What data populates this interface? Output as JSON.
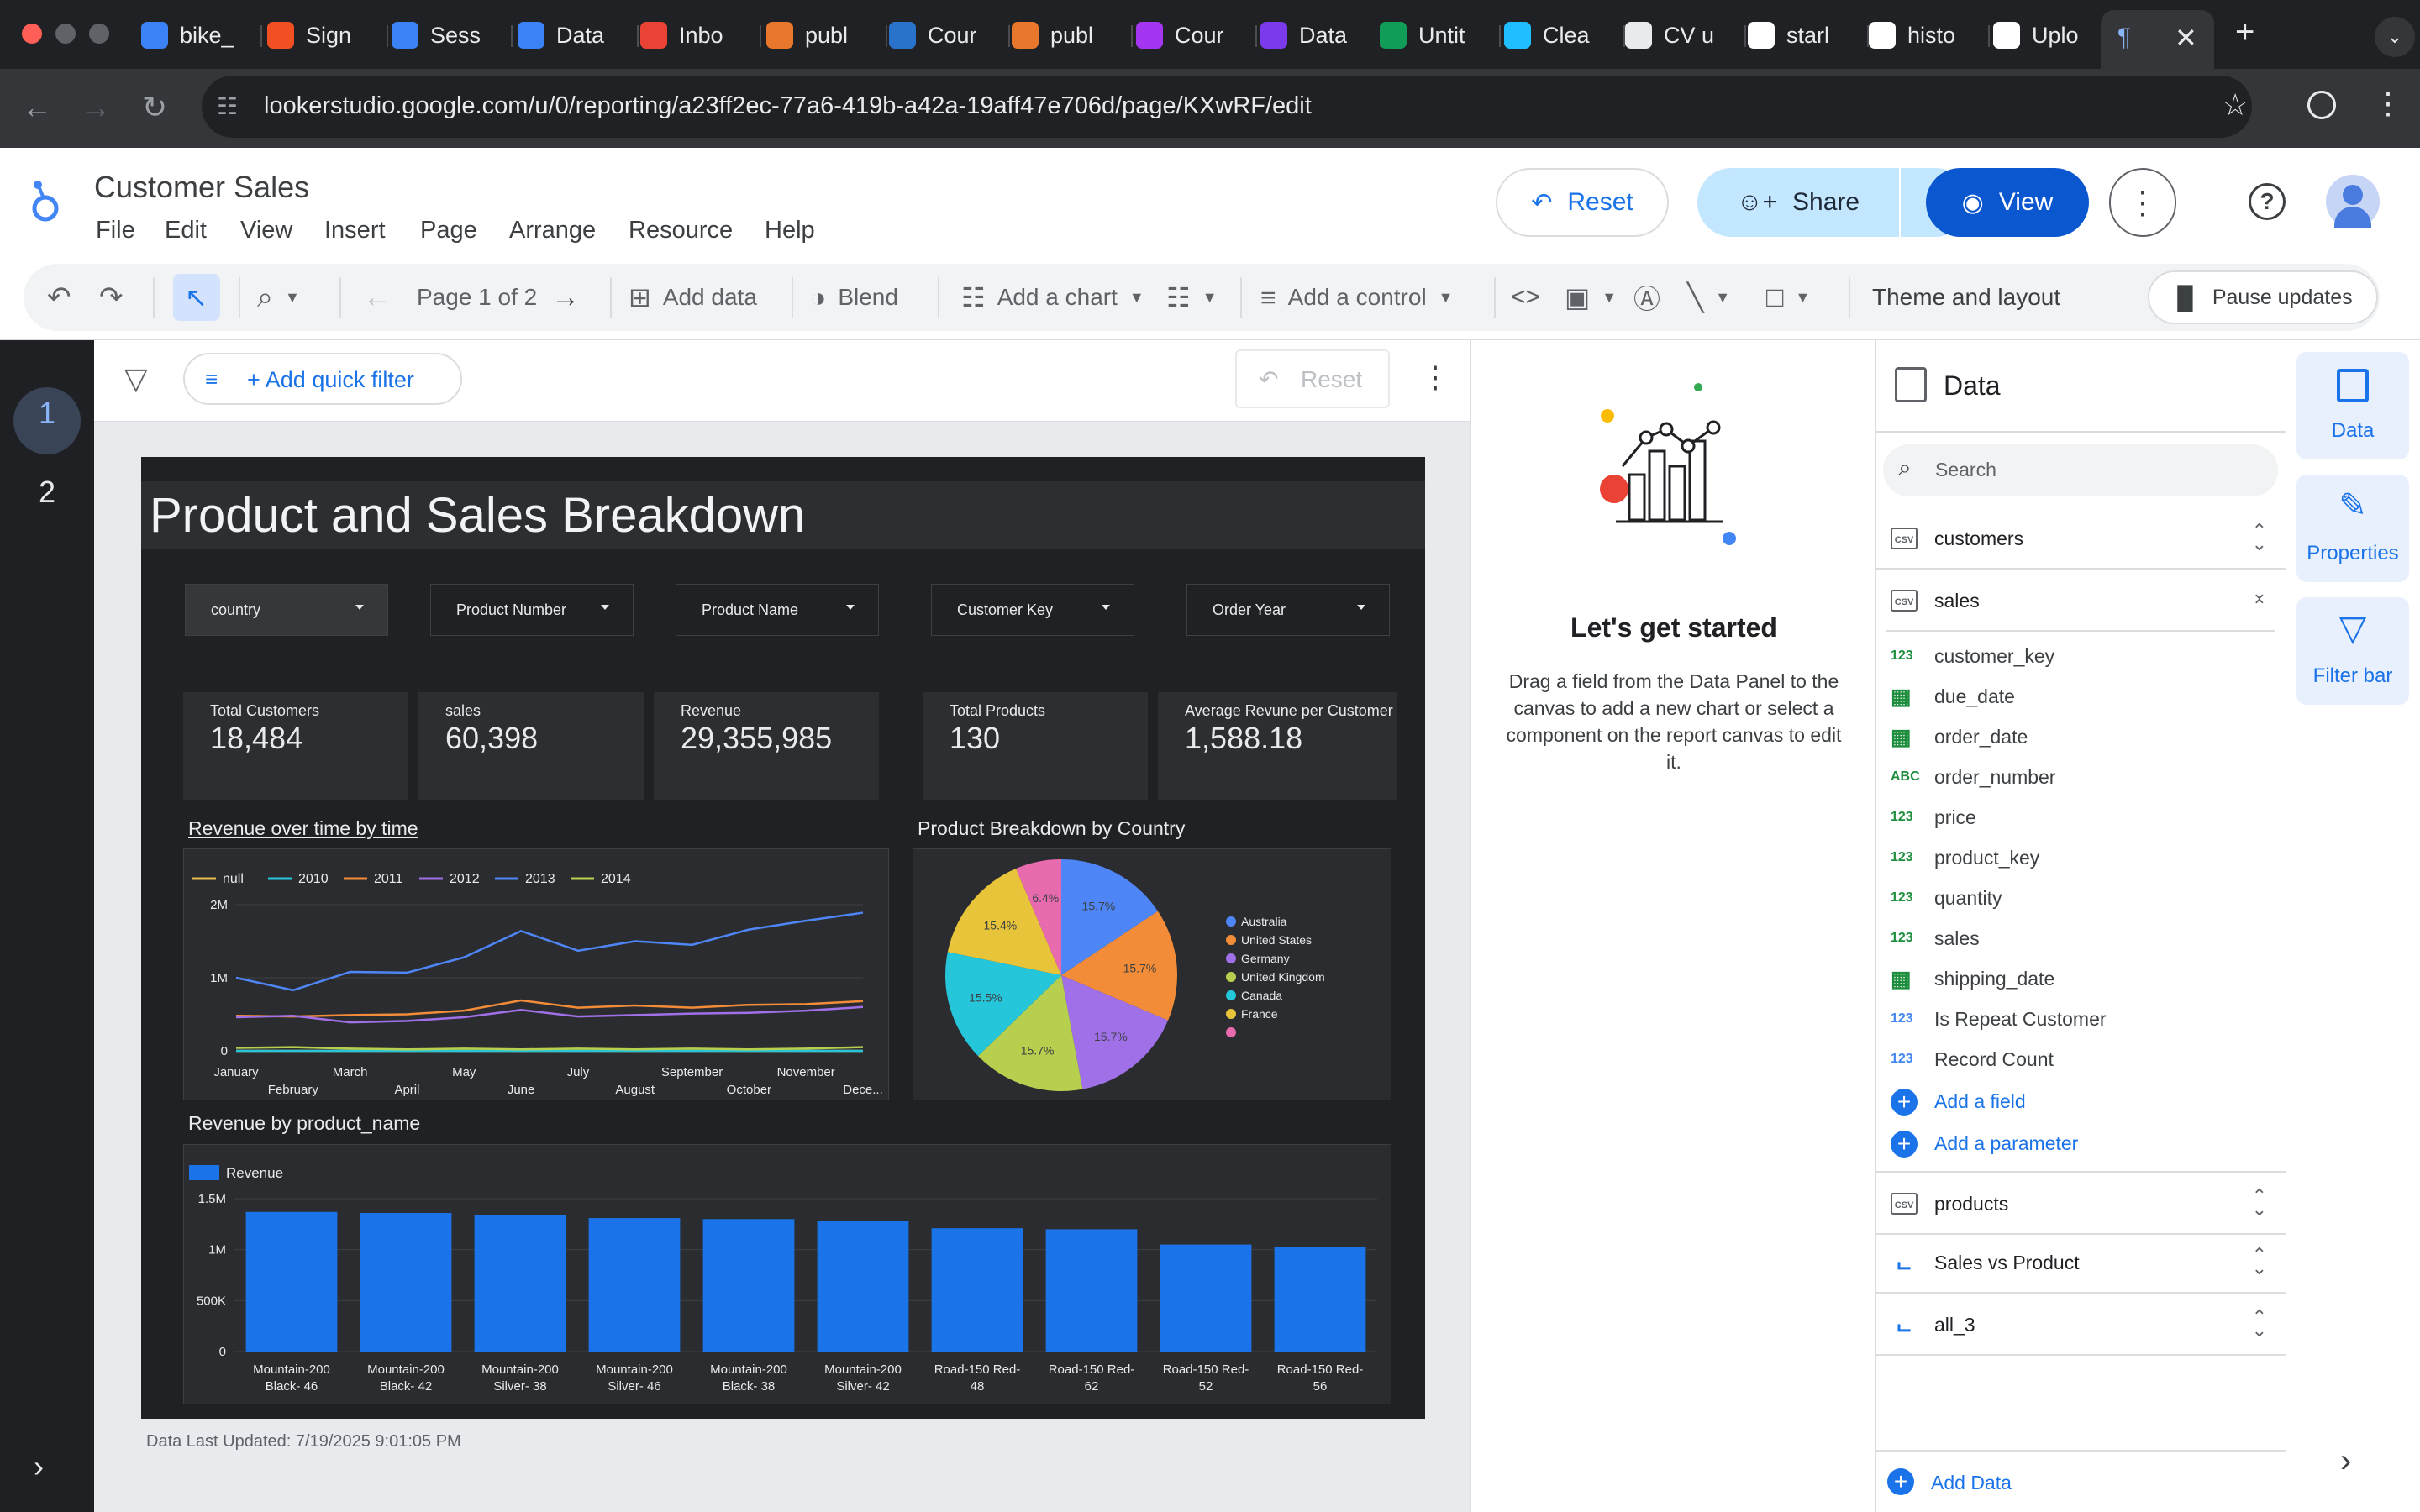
{
  "browser": {
    "tabs": [
      {
        "label": "bike_",
        "icon": "azure-icon",
        "color": "#3b82f6"
      },
      {
        "label": "Sign",
        "icon": "microsoft-icon",
        "color": "#f25022"
      },
      {
        "label": "Sess",
        "icon": "azure-icon",
        "color": "#3b82f6"
      },
      {
        "label": "Data",
        "icon": "azure-icon",
        "color": "#3b82f6"
      },
      {
        "label": "Inbo",
        "icon": "gmail-icon",
        "color": "#ea4335"
      },
      {
        "label": "publ",
        "icon": "tableau-icon",
        "color": "#e8762b"
      },
      {
        "label": "Cour",
        "icon": "coursera-icon",
        "color": "#2a73cc"
      },
      {
        "label": "publ",
        "icon": "tableau-icon",
        "color": "#e8762b"
      },
      {
        "label": "Cour",
        "icon": "udemy-icon",
        "color": "#a435f0"
      },
      {
        "label": "Data",
        "icon": "datacamp-icon",
        "color": "#7c3aed"
      },
      {
        "label": "Untit",
        "icon": "sheets-icon",
        "color": "#0f9d58"
      },
      {
        "label": "Clea",
        "icon": "kaggle-icon",
        "color": "#20beff"
      },
      {
        "label": "CV u",
        "icon": "openai-icon",
        "color": "#e8eaed"
      },
      {
        "label": "starl",
        "icon": "google-icon",
        "color": "#ffffff"
      },
      {
        "label": "histo",
        "icon": "google-icon",
        "color": "#ffffff"
      },
      {
        "label": "Uplo",
        "icon": "github-icon",
        "color": "#ffffff"
      }
    ],
    "active_tab_label": "",
    "url": "lookerstudio.google.com/u/0/reporting/a23ff2ec-77a6-419b-a42a-19aff47e706d/page/KXwRF/edit"
  },
  "header": {
    "title": "Customer Sales",
    "menu": [
      "File",
      "Edit",
      "View",
      "Insert",
      "Page",
      "Arrange",
      "Resource",
      "Help"
    ],
    "reset_label": "Reset",
    "share_label": "Share",
    "view_label": "View"
  },
  "toolbar": {
    "page_label": "Page 1 of 2",
    "add_data": "Add data",
    "blend": "Blend",
    "add_chart": "Add a chart",
    "add_control": "Add a control",
    "theme": "Theme and layout",
    "pause": "Pause updates"
  },
  "pages": [
    "1",
    "2"
  ],
  "filter_bar": {
    "add_quick_filter": "+ Add quick filter",
    "reset": "Reset"
  },
  "report": {
    "title": "Product and Sales Breakdown",
    "controls": [
      "country",
      "Product Number",
      "Product Name",
      "Customer Key",
      "Order Year"
    ],
    "kpis": [
      {
        "label": "Total Customers",
        "value": "18,484"
      },
      {
        "label": "sales",
        "value": "60,398"
      },
      {
        "label": "Revenue",
        "value": "29,355,985"
      },
      {
        "label": "Total Products",
        "value": "130"
      },
      {
        "label": "Average Revune per Customer",
        "value": "1,588.18"
      }
    ],
    "footer": "Data Last Updated: 7/19/2025 9:01:05 PM"
  },
  "chart_data": [
    {
      "type": "line",
      "title": "Revenue over time by time",
      "x": [
        "January",
        "February",
        "March",
        "April",
        "May",
        "June",
        "July",
        "August",
        "September",
        "October",
        "November",
        "December"
      ],
      "x_tick_labels": [
        "January",
        "February",
        "March",
        "April",
        "May",
        "June",
        "July",
        "August",
        "September",
        "October",
        "November",
        "Dece..."
      ],
      "y_ticks": [
        "0",
        "1M",
        "2M"
      ],
      "ylim": [
        0,
        2000000
      ],
      "series": [
        {
          "name": "null",
          "color": "#e8b84a",
          "values": [
            0,
            0,
            0,
            0,
            0,
            0,
            0,
            0,
            0,
            0,
            0,
            0
          ]
        },
        {
          "name": "2010",
          "color": "#26c6da",
          "values": [
            0,
            0,
            0,
            0,
            0,
            0,
            0,
            0,
            0,
            0,
            0,
            0
          ]
        },
        {
          "name": "2011",
          "color": "#f28c38",
          "values": [
            480000,
            470000,
            490000,
            500000,
            550000,
            690000,
            590000,
            620000,
            590000,
            630000,
            640000,
            680000
          ]
        },
        {
          "name": "2012",
          "color": "#a070e8",
          "values": [
            460000,
            480000,
            390000,
            410000,
            460000,
            560000,
            470000,
            490000,
            510000,
            520000,
            550000,
            600000
          ]
        },
        {
          "name": "2013",
          "color": "#4f86f7",
          "values": [
            1000000,
            830000,
            1080000,
            1070000,
            1280000,
            1640000,
            1370000,
            1500000,
            1450000,
            1660000,
            1780000,
            1890000
          ]
        },
        {
          "name": "2014",
          "color": "#b6cf4e",
          "values": [
            40000,
            50000,
            30000,
            20000,
            30000,
            20000,
            30000,
            20000,
            30000,
            20000,
            30000,
            50000
          ]
        }
      ]
    },
    {
      "type": "pie",
      "title": "Product Breakdown by Country",
      "categories": [
        "Australia",
        "United States",
        "Germany",
        "United Kingdom",
        "Canada",
        "France",
        ""
      ],
      "values": [
        15.7,
        15.7,
        15.7,
        15.7,
        15.5,
        15.4,
        6.4
      ],
      "labels": [
        "15.7%",
        "15.7%",
        "15.7%",
        "15.7%",
        "15.5%",
        "15.4%",
        "6.4%"
      ],
      "colors": [
        "#4f86f7",
        "#f28c38",
        "#a070e8",
        "#b6cf4e",
        "#26c6da",
        "#e8c43a",
        "#e86bb0"
      ]
    },
    {
      "type": "bar",
      "title": "Revenue by product_name",
      "legend": "Revenue",
      "categories": [
        "Mountain-200 Black- 46",
        "Mountain-200 Black- 42",
        "Mountain-200 Silver- 38",
        "Mountain-200 Silver- 46",
        "Mountain-200 Black- 38",
        "Mountain-200 Silver- 42",
        "Road-150 Red- 48",
        "Road-150 Red- 62",
        "Road-150 Red- 52",
        "Road-150 Red- 56"
      ],
      "category_lines": [
        [
          "Mountain-200",
          "Black- 46"
        ],
        [
          "Mountain-200",
          "Black- 42"
        ],
        [
          "Mountain-200",
          "Silver- 38"
        ],
        [
          "Mountain-200",
          "Silver- 46"
        ],
        [
          "Mountain-200",
          "Black- 38"
        ],
        [
          "Mountain-200",
          "Silver- 42"
        ],
        [
          "Road-150 Red-",
          "48"
        ],
        [
          "Road-150 Red-",
          "62"
        ],
        [
          "Road-150 Red-",
          "52"
        ],
        [
          "Road-150 Red-",
          "56"
        ]
      ],
      "values": [
        1370000,
        1360000,
        1340000,
        1310000,
        1300000,
        1280000,
        1210000,
        1200000,
        1050000,
        1030000
      ],
      "y_ticks": [
        "0",
        "500K",
        "1M",
        "1.5M"
      ],
      "ylim": [
        0,
        1500000
      ],
      "color": "#1a73e8"
    }
  ],
  "started_panel": {
    "title": "Let's get started",
    "body": "Drag a field from the Data Panel to the canvas to add a new chart or select a component on the report canvas to edit it."
  },
  "data_panel": {
    "title": "Data",
    "search_placeholder": "Search",
    "sources": {
      "customers": "customers",
      "sales": "sales",
      "products": "products",
      "sales_vs_product": "Sales vs Product",
      "all_3": "all_3"
    },
    "sales_fields": [
      {
        "name": "customer_key",
        "type": "123"
      },
      {
        "name": "due_date",
        "type": "date"
      },
      {
        "name": "order_date",
        "type": "date"
      },
      {
        "name": "order_number",
        "type": "ABC"
      },
      {
        "name": "price",
        "type": "123"
      },
      {
        "name": "product_key",
        "type": "123"
      },
      {
        "name": "quantity",
        "type": "123"
      },
      {
        "name": "sales",
        "type": "123"
      },
      {
        "name": "shipping_date",
        "type": "date"
      },
      {
        "name": "Is Repeat Customer",
        "type": "123b"
      },
      {
        "name": "Record Count",
        "type": "123b"
      }
    ],
    "add_field": "Add a field",
    "add_parameter": "Add a parameter",
    "add_data": "Add Data"
  },
  "side_tabs": [
    "Data",
    "Properties",
    "Filter bar"
  ]
}
